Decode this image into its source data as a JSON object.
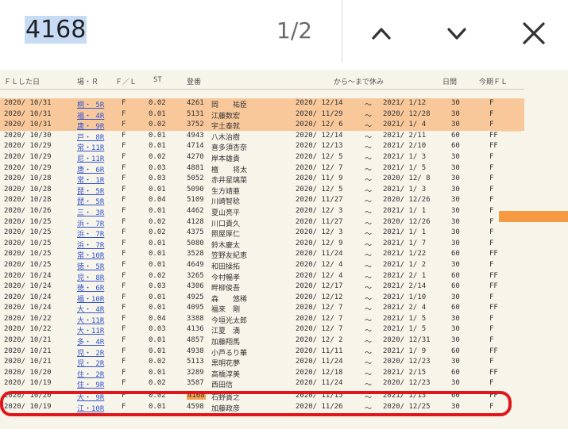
{
  "find": {
    "query": "4168",
    "match_count": "1/2"
  },
  "columns": {
    "date": "ＦＬした日",
    "venue": "場・Ｒ",
    "fl": "Ｆ／Ｌ",
    "st": "ST",
    "reg": "登番",
    "period": "から～まで休み",
    "days": "日間",
    "term": "今期ＦＬ"
  },
  "rows": [
    {
      "date": "2020/ 10/31",
      "venue": "桐・ 5R",
      "fl": "F",
      "st": "0.02",
      "num": "4261",
      "name": "岡　　祐臣",
      "start": "2020/ 12/14",
      "end": "2021/ 1/12",
      "days": "30",
      "flag": "F",
      "hl": true
    },
    {
      "date": "2020/ 10/31",
      "venue": "福・ 4R",
      "fl": "F",
      "st": "0.01",
      "num": "5131",
      "name": "江藤数宏",
      "start": "2020/ 11/29",
      "end": "2020/ 12/28",
      "days": "30",
      "flag": "F",
      "hl": true
    },
    {
      "date": "2020/ 10/31",
      "venue": "唐・ 9R",
      "fl": "F",
      "st": "0.02",
      "num": "3752",
      "name": "宇土泰就",
      "start": "2020/ 12/ 6",
      "end": "2021/ 1/ 4",
      "days": "30",
      "flag": "F",
      "hl": true
    },
    {
      "date": "2020/ 10/30",
      "venue": "戸・ 8R",
      "fl": "F",
      "st": "0.01",
      "num": "4943",
      "name": "八木治樹",
      "start": "2020/ 12/14",
      "end": "2021/ 2/11",
      "days": "60",
      "flag": "FF"
    },
    {
      "date": "2020/ 10/29",
      "venue": "常・11R",
      "fl": "F",
      "st": "0.01",
      "num": "4714",
      "name": "喜多須杏奈",
      "start": "2020/ 12/13",
      "end": "2021/ 2/10",
      "days": "60",
      "flag": "FF"
    },
    {
      "date": "2020/ 10/29",
      "venue": "尼・11R",
      "fl": "F",
      "st": "0.02",
      "num": "4270",
      "name": "岸本雄貴",
      "start": "2020/ 12/ 5",
      "end": "2021/ 1/ 3",
      "days": "30",
      "flag": "F"
    },
    {
      "date": "2020/ 10/29",
      "venue": "唐・ 6R",
      "fl": "F",
      "st": "0.03",
      "num": "4881",
      "name": "檀　　将太",
      "start": "2020/ 12/ 7",
      "end": "2021/ 1/ 5",
      "days": "30",
      "flag": "F"
    },
    {
      "date": "2020/ 10/28",
      "venue": "常・ 1R",
      "fl": "F",
      "st": "0.03",
      "num": "5052",
      "name": "赤井星璃菜",
      "start": "2020/ 11/ 9",
      "end": "2020/ 12/ 8",
      "days": "30",
      "flag": "F"
    },
    {
      "date": "2020/ 10/28",
      "venue": "琵・ 5R",
      "fl": "F",
      "st": "0.01",
      "num": "5090",
      "name": "生方靖亜",
      "start": "2020/ 12/ 5",
      "end": "2021/ 1/ 3",
      "days": "30",
      "flag": "F"
    },
    {
      "date": "2020/ 10/28",
      "venue": "琵・ 5R",
      "fl": "F",
      "st": "0.04",
      "num": "5109",
      "name": "川崎智稔",
      "start": "2020/ 11/27",
      "end": "2020/ 12/26",
      "days": "30",
      "flag": "F"
    },
    {
      "date": "2020/ 10/26",
      "venue": "三・ 3R",
      "fl": "F",
      "st": "0.01",
      "num": "4462",
      "name": "夏山亮平",
      "start": "2020/ 12/ 3",
      "end": "2021/ 1/ 1",
      "days": "30",
      "flag": "F"
    },
    {
      "date": "2020/ 10/25",
      "venue": "浜・ 7R",
      "fl": "F",
      "st": "0.02",
      "num": "4128",
      "name": "川口貴久",
      "start": "2020/ 11/27",
      "end": "2020/ 12/26",
      "days": "30",
      "flag": "F"
    },
    {
      "date": "2020/ 10/25",
      "venue": "浜・ 7R",
      "fl": "F",
      "st": "0.02",
      "num": "4375",
      "name": "照屋厚仁",
      "start": "2020/ 12/ 3",
      "end": "2021/ 1/ 1",
      "days": "30",
      "flag": "F"
    },
    {
      "date": "2020/ 10/25",
      "venue": "浜・ 7R",
      "fl": "F",
      "st": "0.01",
      "num": "5080",
      "name": "鈴木慶太",
      "start": "2020/ 12/ 9",
      "end": "2021/ 1/ 7",
      "days": "30",
      "flag": "F"
    },
    {
      "date": "2020/ 10/25",
      "venue": "常・10R",
      "fl": "F",
      "st": "0.01",
      "num": "3528",
      "name": "笠野友紀恵",
      "start": "2020/ 11/24",
      "end": "2021/ 1/22",
      "days": "60",
      "flag": "FF"
    },
    {
      "date": "2020/ 10/25",
      "venue": "徳・ 5R",
      "fl": "F",
      "st": "0.01",
      "num": "4649",
      "name": "和田操拓",
      "start": "2020/ 12/ 4",
      "end": "2021/ 1/ 2",
      "days": "30",
      "flag": "F"
    },
    {
      "date": "2020/ 10/24",
      "venue": "児・ 8R",
      "fl": "F",
      "st": "0.02",
      "num": "3265",
      "name": "今村暢孝",
      "start": "2020/ 12/ 4",
      "end": "2021/ 2/ 1",
      "days": "60",
      "flag": "FF"
    },
    {
      "date": "2020/ 10/24",
      "venue": "徳・ 6R",
      "fl": "F",
      "st": "0.03",
      "num": "4306",
      "name": "畔柳俊吾",
      "start": "2020/ 12/17",
      "end": "2021/ 2/14",
      "days": "60",
      "flag": "FF"
    },
    {
      "date": "2020/ 10/24",
      "venue": "福・10R",
      "fl": "F",
      "st": "0.01",
      "num": "4925",
      "name": "森　　悠稀",
      "start": "2020/ 12/12",
      "end": "2021/ 1/10",
      "days": "30",
      "flag": "F"
    },
    {
      "date": "2020/ 10/24",
      "venue": "大・ 4R",
      "fl": "F",
      "st": "0.01",
      "num": "4095",
      "name": "福来　剛",
      "start": "2020/ 12/ 7",
      "end": "2021/ 2/ 4",
      "days": "60",
      "flag": "FF"
    },
    {
      "date": "2020/ 10/22",
      "venue": "大・11R",
      "fl": "F",
      "st": "0.04",
      "num": "3388",
      "name": "今垣光太郎",
      "start": "2020/ 12/ 7",
      "end": "2021/ 1/ 5",
      "days": "30",
      "flag": "F"
    },
    {
      "date": "2020/ 10/22",
      "venue": "大・11R",
      "fl": "F",
      "st": "0.03",
      "num": "4136",
      "name": "江夏　満",
      "start": "2020/ 12/ 7",
      "end": "2021/ 1/ 5",
      "days": "30",
      "flag": "F"
    },
    {
      "date": "2020/ 10/21",
      "venue": "多・ 4R",
      "fl": "F",
      "st": "0.01",
      "num": "4857",
      "name": "加藤翔馬",
      "start": "2020/ 12/ 2",
      "end": "2020/ 12/31",
      "days": "30",
      "flag": "F"
    },
    {
      "date": "2020/ 10/21",
      "venue": "児・ 2R",
      "fl": "F",
      "st": "0.01",
      "num": "4938",
      "name": "小芦るり華",
      "start": "2020/ 11/11",
      "end": "2021/ 1/ 9",
      "days": "60",
      "flag": "FF"
    },
    {
      "date": "2020/ 10/21",
      "venue": "児・ 2R",
      "fl": "F",
      "st": "0.02",
      "num": "5113",
      "name": "黒明花夢",
      "start": "2020/ 11/24",
      "end": "2020/ 12/23",
      "days": "30",
      "flag": "F"
    },
    {
      "date": "2020/ 10/20",
      "venue": "住・ 2R",
      "fl": "F",
      "st": "0.01",
      "num": "3289",
      "name": "高橋淳美",
      "start": "2020/ 12/18",
      "end": "2021/ 2/15",
      "days": "60",
      "flag": "FF"
    },
    {
      "date": "2020/ 10/19",
      "venue": "住・ 9R",
      "fl": "F",
      "st": "0.02",
      "num": "3587",
      "name": "西田信",
      "start": "2020/ 11/24",
      "end": "2020/ 12/23",
      "days": "30",
      "flag": "F"
    },
    {
      "date": "2020/ 10/20",
      "venue": "大・ 9R",
      "fl": "F",
      "st": "0.02",
      "num": "4168",
      "name": "石野貴之",
      "start": "2020/ 11/15",
      "end": "2021/ 1/13",
      "days": "60",
      "flag": "FF",
      "match": true
    },
    {
      "date": "2020/ 10/19",
      "venue": "江・10R",
      "fl": "F",
      "st": "0.01",
      "num": "4598",
      "name": "加藤政彦",
      "start": "2020/ 11/26",
      "end": "2020/ 12/25",
      "days": "30",
      "flag": "F"
    }
  ],
  "tilde": "～",
  "colors": {
    "row_highlight": "#f9c89a",
    "match_highlight": "#f4a24f",
    "circle": "#e0161b",
    "query_highlight": "#c8dbf5"
  }
}
